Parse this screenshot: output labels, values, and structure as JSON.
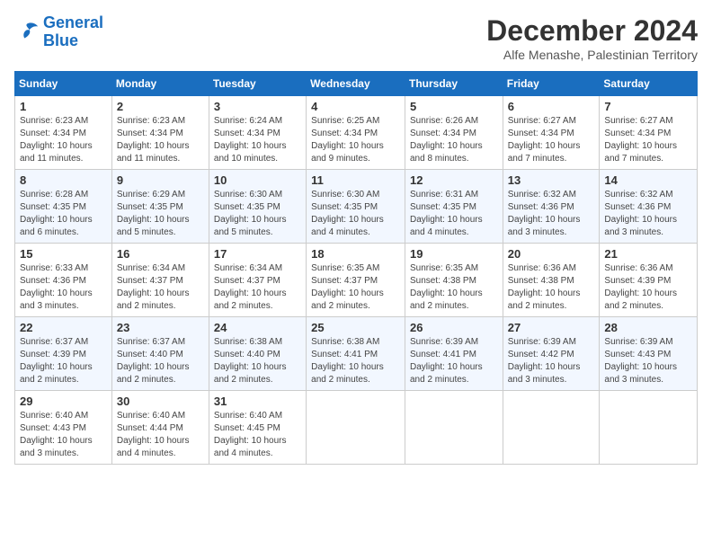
{
  "logo": {
    "line1": "General",
    "line2": "Blue"
  },
  "title": "December 2024",
  "location": "Alfe Menashe, Palestinian Territory",
  "days_of_week": [
    "Sunday",
    "Monday",
    "Tuesday",
    "Wednesday",
    "Thursday",
    "Friday",
    "Saturday"
  ],
  "weeks": [
    [
      {
        "day": "1",
        "sunrise": "6:23 AM",
        "sunset": "4:34 PM",
        "daylight": "10 hours and 11 minutes."
      },
      {
        "day": "2",
        "sunrise": "6:23 AM",
        "sunset": "4:34 PM",
        "daylight": "10 hours and 11 minutes."
      },
      {
        "day": "3",
        "sunrise": "6:24 AM",
        "sunset": "4:34 PM",
        "daylight": "10 hours and 10 minutes."
      },
      {
        "day": "4",
        "sunrise": "6:25 AM",
        "sunset": "4:34 PM",
        "daylight": "10 hours and 9 minutes."
      },
      {
        "day": "5",
        "sunrise": "6:26 AM",
        "sunset": "4:34 PM",
        "daylight": "10 hours and 8 minutes."
      },
      {
        "day": "6",
        "sunrise": "6:27 AM",
        "sunset": "4:34 PM",
        "daylight": "10 hours and 7 minutes."
      },
      {
        "day": "7",
        "sunrise": "6:27 AM",
        "sunset": "4:34 PM",
        "daylight": "10 hours and 7 minutes."
      }
    ],
    [
      {
        "day": "8",
        "sunrise": "6:28 AM",
        "sunset": "4:35 PM",
        "daylight": "10 hours and 6 minutes."
      },
      {
        "day": "9",
        "sunrise": "6:29 AM",
        "sunset": "4:35 PM",
        "daylight": "10 hours and 5 minutes."
      },
      {
        "day": "10",
        "sunrise": "6:30 AM",
        "sunset": "4:35 PM",
        "daylight": "10 hours and 5 minutes."
      },
      {
        "day": "11",
        "sunrise": "6:30 AM",
        "sunset": "4:35 PM",
        "daylight": "10 hours and 4 minutes."
      },
      {
        "day": "12",
        "sunrise": "6:31 AM",
        "sunset": "4:35 PM",
        "daylight": "10 hours and 4 minutes."
      },
      {
        "day": "13",
        "sunrise": "6:32 AM",
        "sunset": "4:36 PM",
        "daylight": "10 hours and 3 minutes."
      },
      {
        "day": "14",
        "sunrise": "6:32 AM",
        "sunset": "4:36 PM",
        "daylight": "10 hours and 3 minutes."
      }
    ],
    [
      {
        "day": "15",
        "sunrise": "6:33 AM",
        "sunset": "4:36 PM",
        "daylight": "10 hours and 3 minutes."
      },
      {
        "day": "16",
        "sunrise": "6:34 AM",
        "sunset": "4:37 PM",
        "daylight": "10 hours and 2 minutes."
      },
      {
        "day": "17",
        "sunrise": "6:34 AM",
        "sunset": "4:37 PM",
        "daylight": "10 hours and 2 minutes."
      },
      {
        "day": "18",
        "sunrise": "6:35 AM",
        "sunset": "4:37 PM",
        "daylight": "10 hours and 2 minutes."
      },
      {
        "day": "19",
        "sunrise": "6:35 AM",
        "sunset": "4:38 PM",
        "daylight": "10 hours and 2 minutes."
      },
      {
        "day": "20",
        "sunrise": "6:36 AM",
        "sunset": "4:38 PM",
        "daylight": "10 hours and 2 minutes."
      },
      {
        "day": "21",
        "sunrise": "6:36 AM",
        "sunset": "4:39 PM",
        "daylight": "10 hours and 2 minutes."
      }
    ],
    [
      {
        "day": "22",
        "sunrise": "6:37 AM",
        "sunset": "4:39 PM",
        "daylight": "10 hours and 2 minutes."
      },
      {
        "day": "23",
        "sunrise": "6:37 AM",
        "sunset": "4:40 PM",
        "daylight": "10 hours and 2 minutes."
      },
      {
        "day": "24",
        "sunrise": "6:38 AM",
        "sunset": "4:40 PM",
        "daylight": "10 hours and 2 minutes."
      },
      {
        "day": "25",
        "sunrise": "6:38 AM",
        "sunset": "4:41 PM",
        "daylight": "10 hours and 2 minutes."
      },
      {
        "day": "26",
        "sunrise": "6:39 AM",
        "sunset": "4:41 PM",
        "daylight": "10 hours and 2 minutes."
      },
      {
        "day": "27",
        "sunrise": "6:39 AM",
        "sunset": "4:42 PM",
        "daylight": "10 hours and 3 minutes."
      },
      {
        "day": "28",
        "sunrise": "6:39 AM",
        "sunset": "4:43 PM",
        "daylight": "10 hours and 3 minutes."
      }
    ],
    [
      {
        "day": "29",
        "sunrise": "6:40 AM",
        "sunset": "4:43 PM",
        "daylight": "10 hours and 3 minutes."
      },
      {
        "day": "30",
        "sunrise": "6:40 AM",
        "sunset": "4:44 PM",
        "daylight": "10 hours and 4 minutes."
      },
      {
        "day": "31",
        "sunrise": "6:40 AM",
        "sunset": "4:45 PM",
        "daylight": "10 hours and 4 minutes."
      },
      null,
      null,
      null,
      null
    ]
  ]
}
